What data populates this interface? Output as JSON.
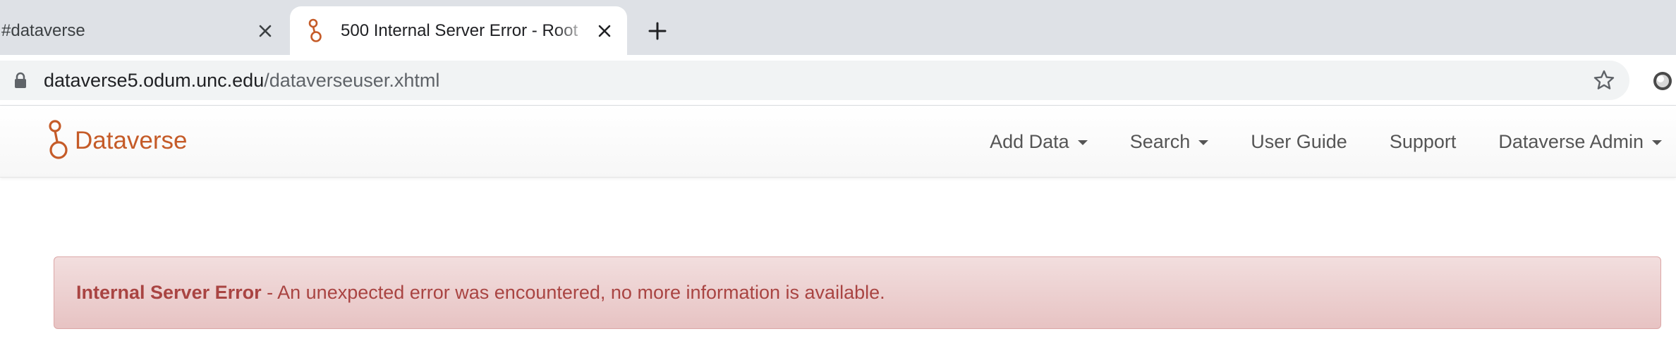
{
  "browser": {
    "tabs": [
      {
        "title": "#dataverse",
        "active": false
      },
      {
        "title": "500 Internal Server Error - Root",
        "active": true
      }
    ],
    "new_tab_icon": "plus-icon",
    "url": {
      "host": "dataverse5.odum.unc.edu",
      "path": "/dataverseuser.xhtml"
    }
  },
  "site": {
    "brand": "Dataverse",
    "brand_color": "#c55b28",
    "nav": {
      "add_data": "Add Data",
      "search": "Search",
      "user_guide": "User Guide",
      "support": "Support",
      "user": "Dataverse Admin"
    }
  },
  "alert": {
    "title": "Internal Server Error",
    "message": " - An unexpected error was encountered, no more information is available.",
    "color": "#a94442"
  }
}
